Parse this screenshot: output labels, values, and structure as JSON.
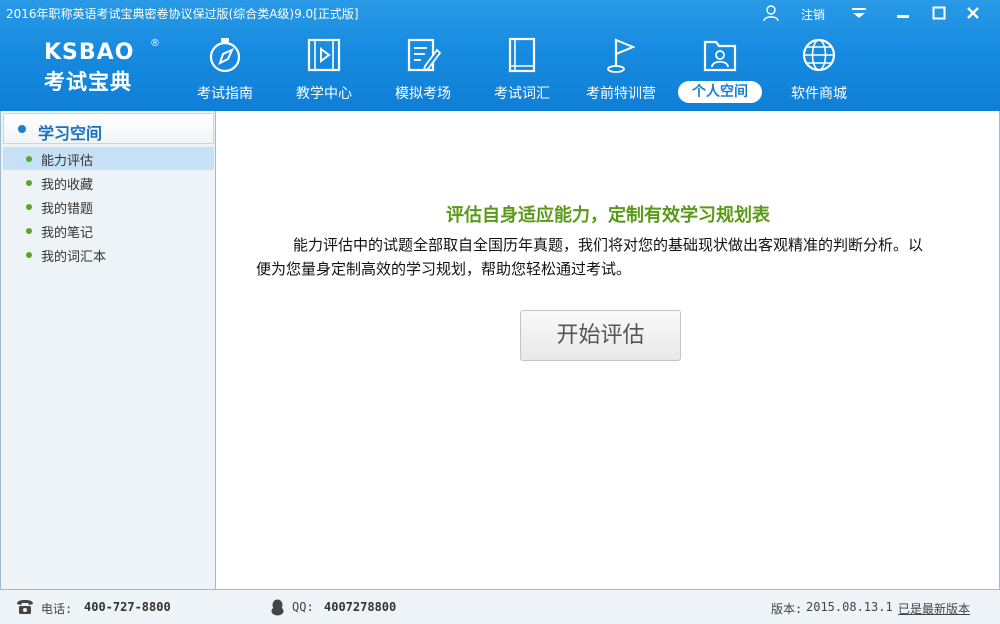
{
  "window": {
    "title": "2016年职称英语考试宝典密卷协议保过版(综合类A级)9.0[正式版]",
    "logout_label": "注销"
  },
  "logo": {
    "brand_en": "KSBAO",
    "registered": "®",
    "brand_cn": "考试宝典"
  },
  "nav": [
    {
      "label": "考试指南",
      "icon": "compass-icon"
    },
    {
      "label": "教学中心",
      "icon": "video-play-icon"
    },
    {
      "label": "模拟考场",
      "icon": "exam-edit-icon"
    },
    {
      "label": "考试词汇",
      "icon": "book-icon"
    },
    {
      "label": "考前特训营",
      "icon": "flag-icon"
    },
    {
      "label": "个人空间",
      "icon": "user-folder-icon",
      "active": true
    },
    {
      "label": "软件商城",
      "icon": "globe-icon"
    }
  ],
  "sidebar": {
    "title": "学习空间",
    "items": [
      {
        "label": "能力评估",
        "active": true
      },
      {
        "label": "我的收藏"
      },
      {
        "label": "我的错题"
      },
      {
        "label": "我的笔记"
      },
      {
        "label": "我的词汇本"
      }
    ]
  },
  "main": {
    "heading": "评估自身适应能力，定制有效学习规划表",
    "description": "能力评估中的试题全部取自全国历年真题，我们将对您的基础现状做出客观精准的判断分析。以便为您量身定制高效的学习规划，帮助您轻松通过考试。",
    "start_button": "开始评估"
  },
  "footer": {
    "phone_label": "电话:",
    "phone": "400-727-8800",
    "qq_label": "QQ:",
    "qq": "4007278800",
    "version_label": "版本:",
    "version": "2015.08.13.1",
    "update_status": "已是最新版本"
  },
  "colors": {
    "header_blue": "#178be0",
    "active_nav_text": "#1a7fd1",
    "heading_green": "#5a9a18",
    "bullet_green": "#5ba52a",
    "sidebar_active_bg": "#c6e0f6"
  }
}
